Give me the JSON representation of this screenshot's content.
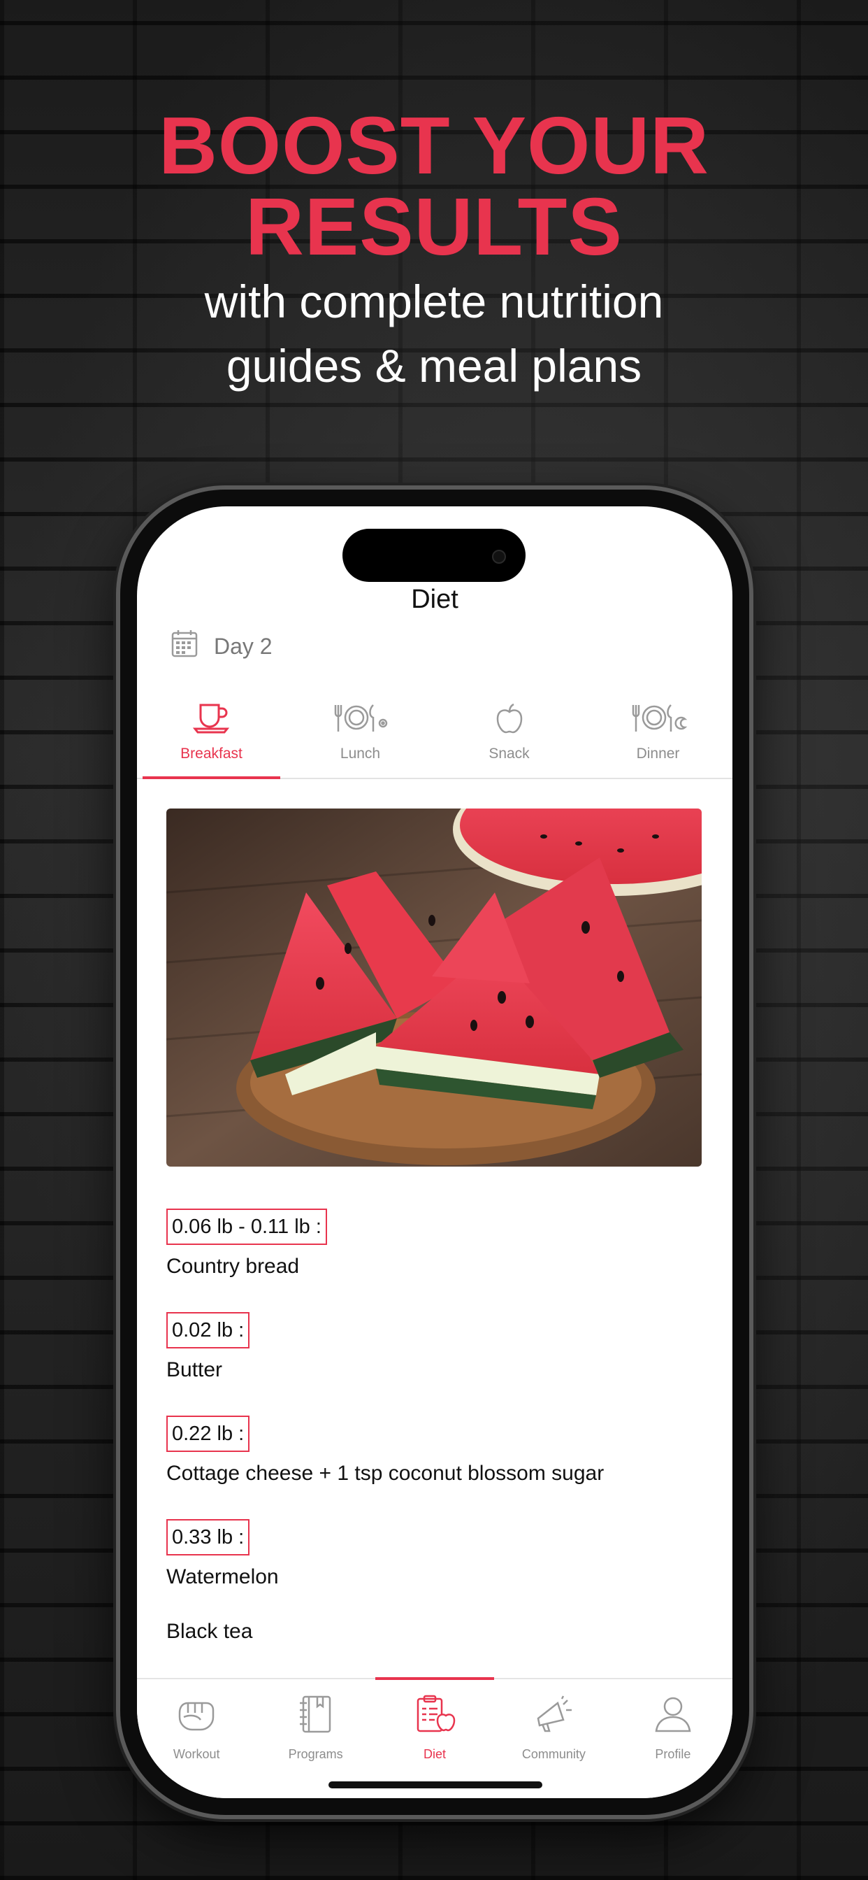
{
  "promo": {
    "headline_line1": "BOOST YOUR",
    "headline_line2": "RESULTS",
    "sub_line1": "with complete nutrition",
    "sub_line2": "guides & meal plans"
  },
  "app": {
    "title": "Diet",
    "day_label": "Day 2",
    "tabs": [
      {
        "label": "Breakfast",
        "icon": "cup-icon",
        "active": true
      },
      {
        "label": "Lunch",
        "icon": "plate-cutlery-icon",
        "active": false
      },
      {
        "label": "Snack",
        "icon": "apple-icon",
        "active": false
      },
      {
        "label": "Dinner",
        "icon": "plate-moon-icon",
        "active": false
      }
    ],
    "meal_image": "watermelon-slices-photo",
    "items": [
      {
        "quantity": "0.06 lb - 0.11 lb :",
        "food": "Country bread"
      },
      {
        "quantity": "0.02 lb :",
        "food": "Butter"
      },
      {
        "quantity": "0.22 lb :",
        "food": "Cottage cheese + 1 tsp coconut blossom sugar"
      },
      {
        "quantity": "0.33 lb :",
        "food": "Watermelon"
      }
    ],
    "extra_item": "Black tea",
    "bottom_nav": [
      {
        "label": "Workout",
        "icon": "fist-icon",
        "active": false
      },
      {
        "label": "Programs",
        "icon": "notebook-icon",
        "active": false
      },
      {
        "label": "Diet",
        "icon": "diet-clipboard-icon",
        "active": true
      },
      {
        "label": "Community",
        "icon": "megaphone-icon",
        "active": false
      },
      {
        "label": "Profile",
        "icon": "person-icon",
        "active": false
      }
    ]
  },
  "colors": {
    "accent": "#e8344e",
    "inactive": "#8d8d8d"
  }
}
